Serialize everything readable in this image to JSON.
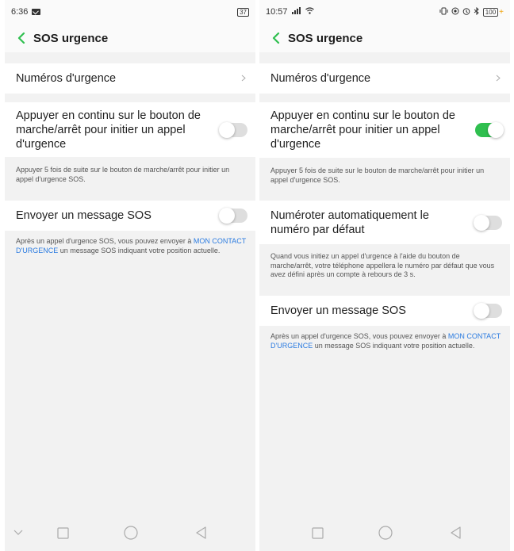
{
  "left": {
    "status": {
      "time": "6:36",
      "battery": "37"
    },
    "header": {
      "title": "SOS urgence"
    },
    "emergency_numbers": {
      "label": "Numéros d'urgence"
    },
    "power_button_call": {
      "label": "Appuyer en continu sur le bouton de marche/arrêt pour initier un appel d'urgence",
      "enabled": false,
      "description": "Appuyer 5 fois de suite sur le bouton de marche/arrêt pour initier un appel d'urgence SOS."
    },
    "send_sos": {
      "label": "Envoyer un message SOS",
      "enabled": false,
      "description_before": "Après un appel d'urgence SOS, vous pouvez envoyer à ",
      "description_link": "MON CONTACT D'URGENCE",
      "description_after": " un message SOS indiquant votre position actuelle."
    }
  },
  "right": {
    "status": {
      "time": "10:57",
      "battery": "100"
    },
    "header": {
      "title": "SOS urgence"
    },
    "emergency_numbers": {
      "label": "Numéros d'urgence"
    },
    "power_button_call": {
      "label": "Appuyer en continu sur le bouton de marche/arrêt pour initier un appel d'urgence",
      "enabled": true,
      "description": "Appuyer 5 fois de suite sur le bouton de marche/arrêt pour initier un appel d'urgence SOS."
    },
    "auto_dial": {
      "label": "Numéroter automatiquement le numéro par défaut",
      "enabled": false,
      "description": "Quand vous initiez un appel d'urgence à l'aide du bouton de marche/arrêt, votre téléphone appellera le numéro par défaut que vous avez défini après un compte à rebours de 3 s."
    },
    "send_sos": {
      "label": "Envoyer un message SOS",
      "enabled": false,
      "description_before": "Après un appel d'urgence SOS, vous pouvez envoyer à ",
      "description_link": "MON CONTACT D'URGENCE",
      "description_after": " un message SOS indiquant votre position actuelle."
    }
  },
  "colors": {
    "accent": "#2fbf4f",
    "link": "#2b7be0",
    "background": "#f2f2f2"
  },
  "icons": [
    "back-chevron-icon",
    "chevron-right-icon",
    "mail-icon",
    "signal-icon",
    "wifi-icon",
    "alarm-icon",
    "bluetooth-icon",
    "battery-icon",
    "nav-down-icon",
    "nav-square-icon",
    "nav-circle-icon",
    "nav-triangle-icon"
  ]
}
